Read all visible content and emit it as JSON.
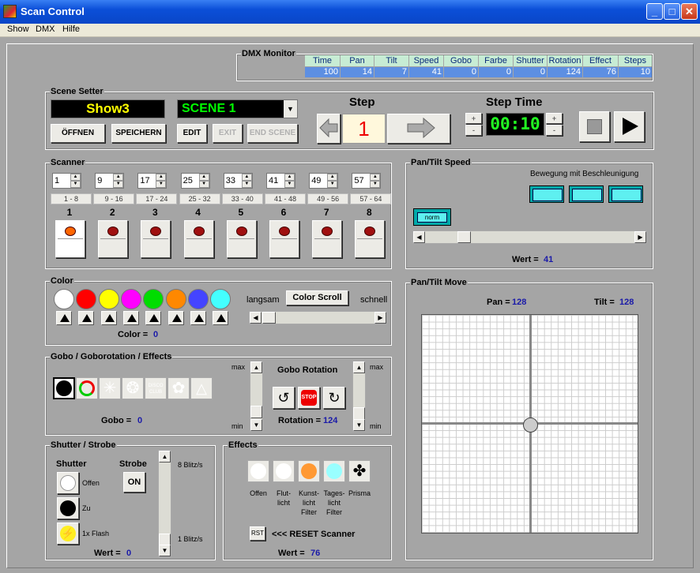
{
  "window": {
    "title": "Scan Control",
    "min": "_",
    "max": "□",
    "close": "✕"
  },
  "menu": [
    "Show",
    "DMX",
    "Hilfe"
  ],
  "dmx": {
    "title": "DMX Monitor",
    "headers": [
      "Time",
      "Pan",
      "Tilt",
      "Speed",
      "Gobo",
      "Farbe",
      "Shutter",
      "Rotation",
      "Effect",
      "Steps"
    ],
    "values": [
      "100",
      "14",
      "7",
      "41",
      "0",
      "0",
      "0",
      "124",
      "76",
      "10"
    ]
  },
  "scene": {
    "title": "Scene Setter",
    "show_name": "Show3",
    "scene_select": "SCENE 1",
    "open": "ÖFFNEN",
    "save": "SPEICHERN",
    "edit": "EDIT",
    "exit": "EXIT",
    "end_scene": "END SCENE",
    "step_label": "Step",
    "step_value": "1",
    "step_time_label": "Step Time",
    "step_time": "00:10",
    "plus": "+",
    "minus": "-"
  },
  "scanner": {
    "title": "Scanner",
    "channels": [
      "1",
      "9",
      "17",
      "25",
      "33",
      "41",
      "49",
      "57"
    ],
    "ranges": [
      "1 - 8",
      "9 - 16",
      "17 - 24",
      "25 - 32",
      "33 - 40",
      "41 - 48",
      "49 - 56",
      "57 - 64"
    ],
    "numbers": [
      "1",
      "2",
      "3",
      "4",
      "5",
      "6",
      "7",
      "8"
    ]
  },
  "color": {
    "title": "Color",
    "swatches": [
      "#ffffff",
      "#ff0000",
      "#ffff00",
      "#ff00ff",
      "#00dd00",
      "#ff8800",
      "#4444ff",
      "#44ffff"
    ],
    "slow": "langsam",
    "fast": "schnell",
    "scroll": "Color Scroll",
    "value_label": "Color =",
    "value": "0"
  },
  "gobo": {
    "title": "Gobo / Goborotation / Effects",
    "max": "max",
    "min": "min",
    "rotation_title": "Gobo Rotation",
    "stop": "STOP",
    "value_label": "Gobo =",
    "value": "0",
    "rotation_label": "Rotation =",
    "rotation_value": "124",
    "disco_text": "DISCO CLUB"
  },
  "shutter": {
    "title": "Shutter / Strobe",
    "shutter_label": "Shutter",
    "strobe_label": "Strobe",
    "on": "ON",
    "open": "Offen",
    "closed": "Zu",
    "flash": "1x Flash",
    "fast": "8 Blitz/s",
    "slow": "1 Blitz/s",
    "value_label": "Wert =",
    "value": "0"
  },
  "effects": {
    "title": "Effects",
    "items": [
      "Offen",
      "Flut-|licht",
      "Kunst-|licht|Filter",
      "Tages-|licht|Filter",
      "Prisma"
    ],
    "rst": "RST",
    "reset": "<<<  RESET Scanner",
    "value_label": "Wert =",
    "value": "76"
  },
  "speed": {
    "title": "Pan/Tilt Speed",
    "accel": "Bewegung mit  Beschleunigung",
    "norm": "norm",
    "value_label": "Wert =",
    "value": "41",
    "level": 41
  },
  "move": {
    "title": "Pan/Tilt Move",
    "pan_label": "Pan =",
    "pan": "128",
    "tilt_label": "Tilt =",
    "tilt": "128"
  }
}
